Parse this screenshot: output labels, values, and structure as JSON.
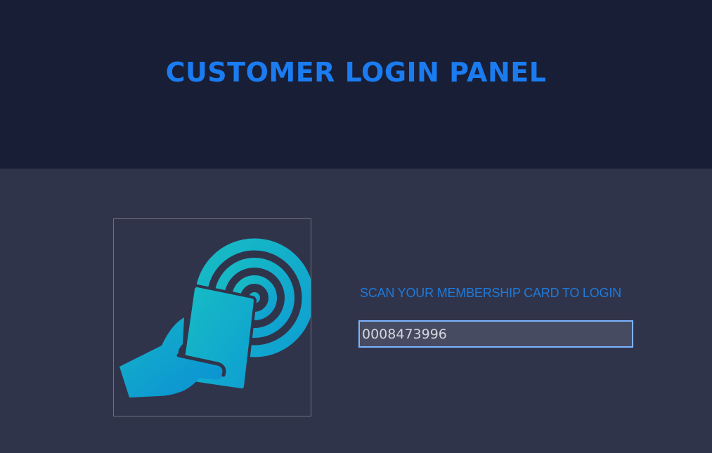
{
  "header": {
    "title": "CUSTOMER LOGIN PANEL"
  },
  "login": {
    "instruction": "SCAN YOUR MEMBERSHIP CARD TO LOGIN",
    "card_input_value": "0008473996",
    "card_icon": "hand-scanning-card-icon"
  },
  "colors": {
    "header_bg": "#181e36",
    "body_bg": "#30344b",
    "accent_blue": "#1a7cf0",
    "icon_teal": "#14b6c4",
    "icon_blue": "#0a9ad6"
  }
}
